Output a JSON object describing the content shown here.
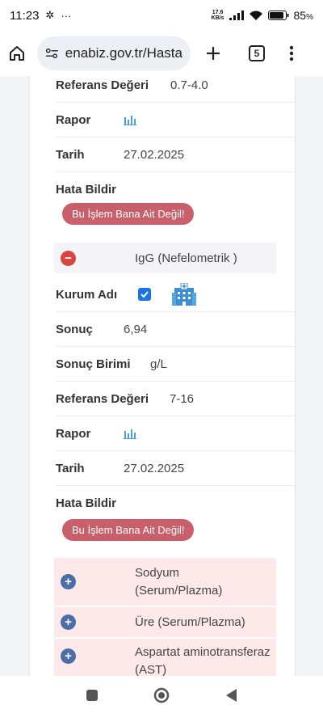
{
  "status_bar": {
    "time": "11:23",
    "net_speed_value": "17.6",
    "net_speed_unit": "KB/s",
    "battery": "85"
  },
  "browser": {
    "url": "enabiz.gov.tr/Hasta",
    "tab_count": "5"
  },
  "top_section": {
    "ref_label": "Referans Değeri",
    "ref_value": "0.7-4.0",
    "rapor_label": "Rapor",
    "tarih_label": "Tarih",
    "tarih_value": "27.02.2025",
    "hata_label": "Hata Bildir",
    "hata_button": "Bu İşlem Bana Ait Değil!"
  },
  "igg": {
    "name": "IgG (Nefelometrik )",
    "kurum_label": "Kurum Adı",
    "sonuc_label": "Sonuç",
    "sonuc_value": "6,94",
    "birim_label": "Sonuç Birimi",
    "birim_value": "g/L",
    "ref_label": "Referans Değeri",
    "ref_value": "7-16",
    "rapor_label": "Rapor",
    "tarih_label": "Tarih",
    "tarih_value": "27.02.2025",
    "hata_label": "Hata Bildir",
    "hata_button": "Bu İşlem Bana Ait Değil!"
  },
  "collapsed_tests": [
    {
      "name": "Sodyum (Serum/Plazma)"
    },
    {
      "name": "Üre (Serum/Plazma)"
    },
    {
      "name": "Aspartat aminotransferaz (AST)"
    }
  ],
  "colors": {
    "minus": "#d9453f",
    "plus": "#4c6ea6",
    "error_button": "#c95f6a",
    "abnormal_bg": "#fde8ea",
    "checkbox": "#1a73e8"
  }
}
